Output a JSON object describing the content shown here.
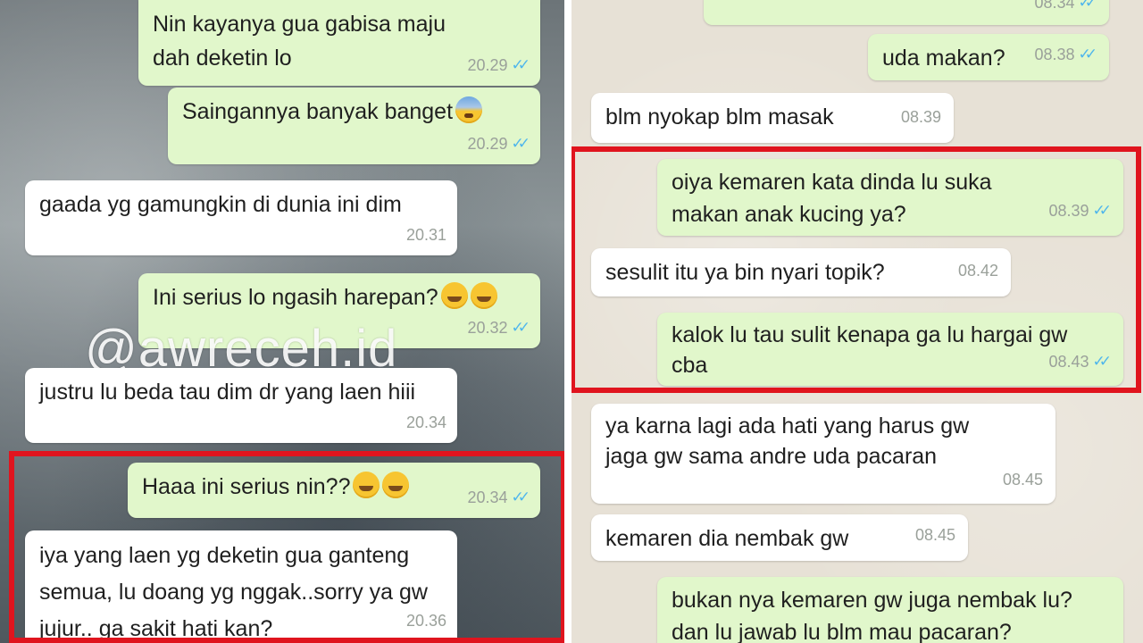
{
  "left": {
    "watermark": "@awreceh.id",
    "messages": [
      {
        "dir": "out",
        "text": "Nin kayanya gua gabisa maju dah deketin lo",
        "time": "20.29",
        "emoji": ""
      },
      {
        "dir": "out",
        "text": "Saingannya banyak banget",
        "time": "20.29",
        "emoji": "fearful-face"
      },
      {
        "dir": "in",
        "text": "gaada yg gamungkin di dunia ini dim",
        "time": "20.31",
        "emoji": ""
      },
      {
        "dir": "out",
        "text": "Ini serius lo ngasih harepan?",
        "time": "20.32",
        "emoji": "grinning-squinting-face x2"
      },
      {
        "dir": "in",
        "text": "justru lu beda tau dim dr yang laen hiii",
        "time": "20.34",
        "emoji": ""
      },
      {
        "dir": "out",
        "text": "Haaa ini serius nin??",
        "time": "20.34",
        "emoji": "grinning-face x2"
      },
      {
        "dir": "in",
        "text": "iya yang laen yg deketin gua ganteng semua, lu doang yg nggak..sorry ya gw jujur.. ga sakit hati kan?",
        "time": "20.36",
        "emoji": ""
      }
    ]
  },
  "right": {
    "messages": [
      {
        "dir": "out",
        "text": "",
        "time": "08.34"
      },
      {
        "dir": "out",
        "text": "uda makan?",
        "time": "08.38"
      },
      {
        "dir": "in",
        "text": "blm nyokap blm masak",
        "time": "08.39"
      },
      {
        "dir": "out",
        "text": "oiya kemaren kata dinda lu suka makan anak kucing ya?",
        "time": "08.39"
      },
      {
        "dir": "in",
        "text": "sesulit itu ya bin nyari topik?",
        "time": "08.42"
      },
      {
        "dir": "out",
        "text": "kalok lu tau sulit kenapa ga lu hargai gw cba",
        "time": "08.43"
      },
      {
        "dir": "in",
        "text": "ya karna lagi ada hati yang harus gw jaga gw sama andre uda pacaran",
        "time": "08.45"
      },
      {
        "dir": "in",
        "text": "kemaren dia nembak gw",
        "time": "08.45"
      },
      {
        "dir": "out",
        "text": "bukan nya kemaren gw juga nembak lu?dan lu jawab lu blm mau pacaran?",
        "time": ""
      }
    ]
  },
  "colors": {
    "outgoing_bubble": "#e1f7cb",
    "incoming_bubble": "#ffffff",
    "highlight_box": "#e0141e",
    "read_ticks": "#4fb6ec"
  },
  "icons": {
    "read_receipt": "double-check-icon"
  }
}
